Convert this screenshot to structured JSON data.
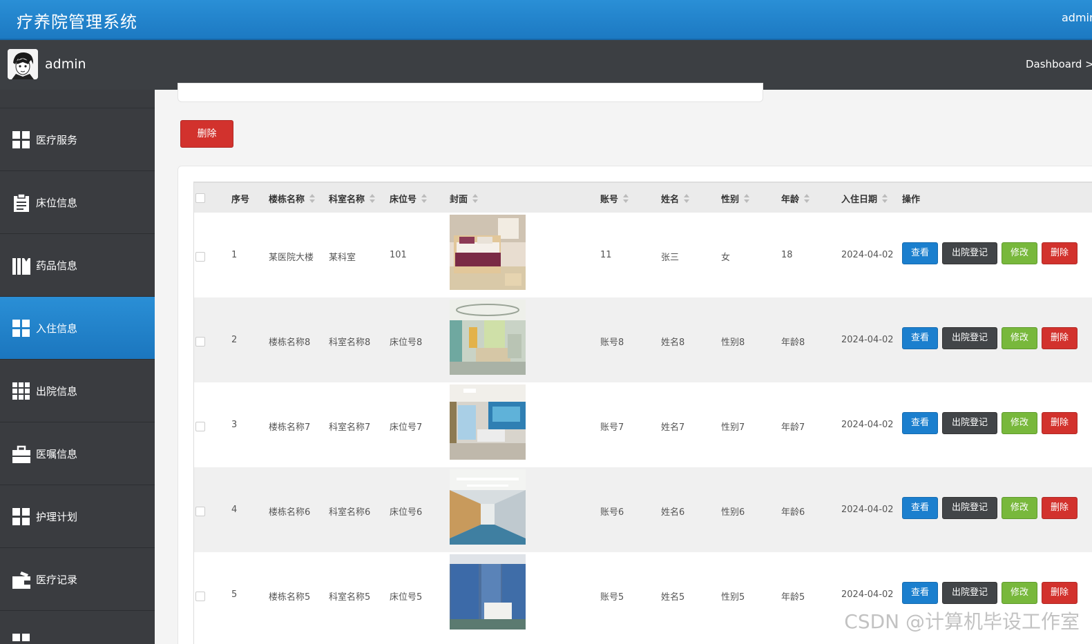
{
  "app": {
    "title": "疗养院管理系统",
    "top_user": "admin"
  },
  "userbar": {
    "username": "admin",
    "breadcrumb": "Dashboard >"
  },
  "sidebar": {
    "items": [
      {
        "label": "医疗服务",
        "icon": "grid-icon"
      },
      {
        "label": "床位信息",
        "icon": "clipboard-icon"
      },
      {
        "label": "药品信息",
        "icon": "books-icon"
      },
      {
        "label": "入住信息",
        "icon": "grid-icon",
        "active": true
      },
      {
        "label": "出院信息",
        "icon": "grid-nine-icon"
      },
      {
        "label": "医嘱信息",
        "icon": "briefcase-icon"
      },
      {
        "label": "护理计划",
        "icon": "grid-icon"
      },
      {
        "label": "医疗记录",
        "icon": "wallet-icon"
      }
    ]
  },
  "toolbar": {
    "delete_label": "删除"
  },
  "table": {
    "columns": [
      "序号",
      "楼栋名称",
      "科室名称",
      "床位号",
      "封面",
      "账号",
      "姓名",
      "性别",
      "年龄",
      "入住日期",
      "操作"
    ],
    "rows": [
      {
        "no": "1",
        "building": "某医院大楼",
        "dept": "某科室",
        "bed": "101",
        "account": "11",
        "name": "张三",
        "gender": "女",
        "age": "18",
        "date": "2024-04-02"
      },
      {
        "no": "2",
        "building": "楼栋名称8",
        "dept": "科室名称8",
        "bed": "床位号8",
        "account": "账号8",
        "name": "姓名8",
        "gender": "性别8",
        "age": "年龄8",
        "date": "2024-04-02"
      },
      {
        "no": "3",
        "building": "楼栋名称7",
        "dept": "科室名称7",
        "bed": "床位号7",
        "account": "账号7",
        "name": "姓名7",
        "gender": "性别7",
        "age": "年龄7",
        "date": "2024-04-02"
      },
      {
        "no": "4",
        "building": "楼栋名称6",
        "dept": "科室名称6",
        "bed": "床位号6",
        "account": "账号6",
        "name": "姓名6",
        "gender": "性别6",
        "age": "年龄6",
        "date": "2024-04-02"
      },
      {
        "no": "5",
        "building": "楼栋名称5",
        "dept": "科室名称5",
        "bed": "床位号5",
        "account": "账号5",
        "name": "姓名5",
        "gender": "性别5",
        "age": "年龄5",
        "date": "2024-04-02"
      }
    ],
    "actions": {
      "view": "查看",
      "discharge": "出院登记",
      "edit": "修改",
      "delete": "删除"
    }
  },
  "watermark": "CSDN @计算机毕设工作室",
  "colors": {
    "primary": "#1b7fce",
    "header": "#2a8fd6",
    "sidebar": "#3a3c40",
    "danger": "#d2322d",
    "success": "#78b83c",
    "dark": "#424548"
  }
}
